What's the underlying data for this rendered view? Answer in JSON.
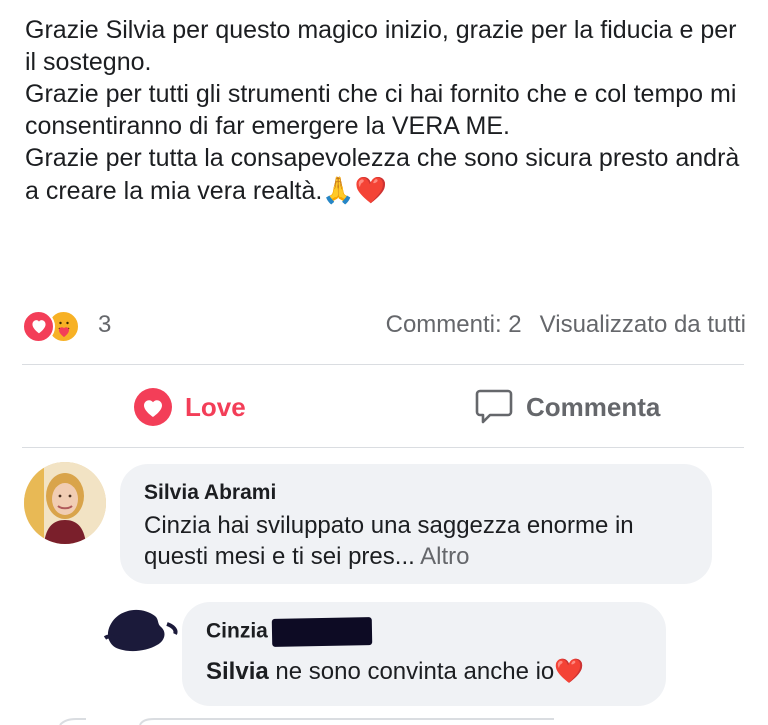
{
  "post": {
    "line1": "Grazie Silvia per questo magico inizio, grazie per la fiducia e per il sostegno.",
    "line2": "Grazie per tutti gli strumenti che ci hai fornito che e col tempo mi consentiranno di far emergere la VERA ME.",
    "line3": "Grazie per tutta la consapevolezza che sono sicura presto andrà a creare la mia vera realtà.",
    "line3_emojis": "🙏❤️"
  },
  "reactions": {
    "count": "3",
    "comments": "Commenti: 2",
    "visibility": "Visualizzato da tutti",
    "icons": [
      "love-reaction-icon",
      "care-reaction-icon"
    ]
  },
  "actions": {
    "love": "Love",
    "comment": "Commenta"
  },
  "comments": [
    {
      "author": "Silvia Abrami",
      "text": "Cinzia hai sviluppato una saggezza enorme in questi mesi e ti sei pres...",
      "more": "Altro"
    },
    {
      "author": "Cinzia",
      "mention": "Silvia",
      "text": " ne sono convinta anche io",
      "emoji": "❤️"
    }
  ],
  "colors": {
    "love": "#f33e58",
    "secondary_text": "#65676b",
    "bubble": "#f0f2f5"
  }
}
